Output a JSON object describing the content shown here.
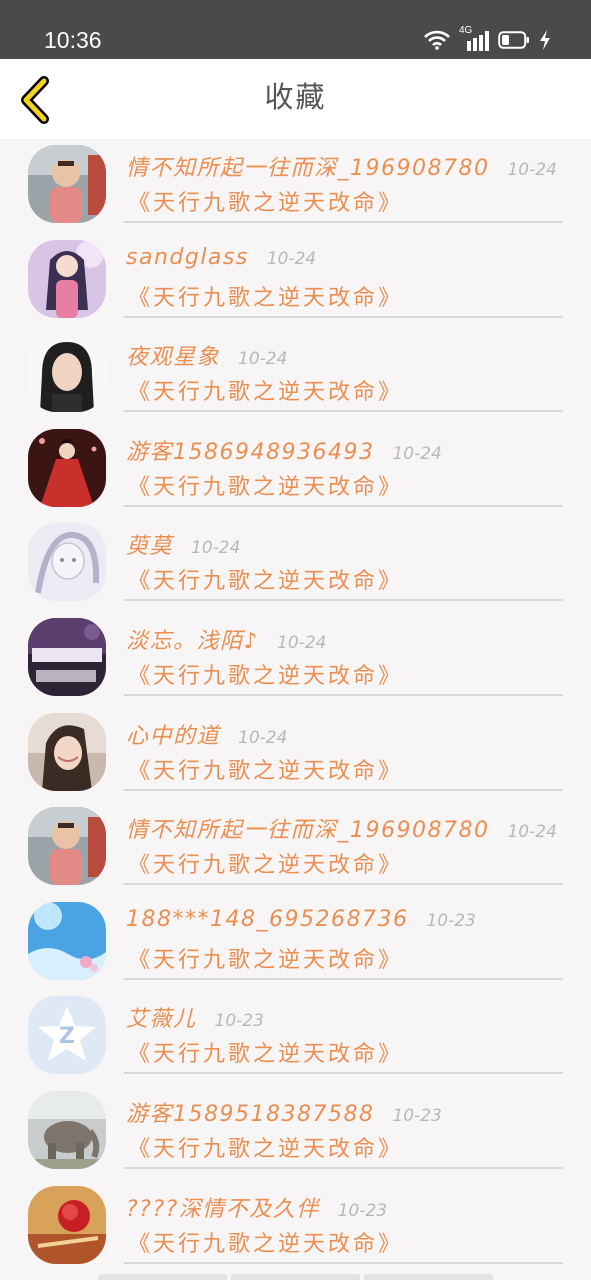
{
  "status_bar": {
    "time": "10:36",
    "network": "4G",
    "icons": [
      "wifi-icon",
      "signal-icon",
      "battery-icon",
      "charging-icon"
    ]
  },
  "header": {
    "title": "收藏",
    "back_icon": "chevron-left-icon"
  },
  "colors": {
    "accent": "#ea8f51",
    "muted": "#b8b8b8",
    "title": "#555555",
    "status_bar": "#4a4a4a"
  },
  "items": [
    {
      "name": "情不知所起一往而深_196908780",
      "time": "10-24",
      "work": "《天行九歌之逆天改命》",
      "avatar": "toddler-photo-avatar"
    },
    {
      "name": "sandglass",
      "time": "10-24",
      "work": "《天行九歌之逆天改命》",
      "avatar": "anime-girl-avatar"
    },
    {
      "name": "夜观星象",
      "time": "10-24",
      "work": "《天行九歌之逆天改命》",
      "avatar": "portrait-photo-avatar"
    },
    {
      "name": "游客1586948936493",
      "time": "10-24",
      "work": "《天行九歌之逆天改命》",
      "avatar": "red-dress-figure-avatar"
    },
    {
      "name": "萸莫",
      "time": "10-24",
      "work": "《天行九歌之逆天改命》",
      "avatar": "sketch-girl-avatar"
    },
    {
      "name": "淡忘。浅陌♪",
      "time": "10-24",
      "work": "《天行九歌之逆天改命》",
      "avatar": "dark-text-avatar"
    },
    {
      "name": "心中的道",
      "time": "10-24",
      "work": "《天行九歌之逆天改命》",
      "avatar": "selfie-photo-avatar"
    },
    {
      "name": "情不知所起一往而深_196908780",
      "time": "10-24",
      "work": "《天行九歌之逆天改命》",
      "avatar": "toddler-photo-avatar"
    },
    {
      "name": "188***148_695268736",
      "time": "10-23",
      "work": "《天行九歌之逆天改命》",
      "avatar": "blue-sky-avatar"
    },
    {
      "name": "艾薇儿",
      "time": "10-23",
      "work": "《天行九歌之逆天改命》",
      "avatar": "default-qq-avatar"
    },
    {
      "name": "游客1589518387588",
      "time": "10-23",
      "work": "《天行九歌之逆天改命》",
      "avatar": "elephant-statue-avatar"
    },
    {
      "name": "????深情不及久伴",
      "time": "10-23",
      "work": "《天行九歌之逆天改命》",
      "avatar": "rose-gift-avatar"
    }
  ]
}
